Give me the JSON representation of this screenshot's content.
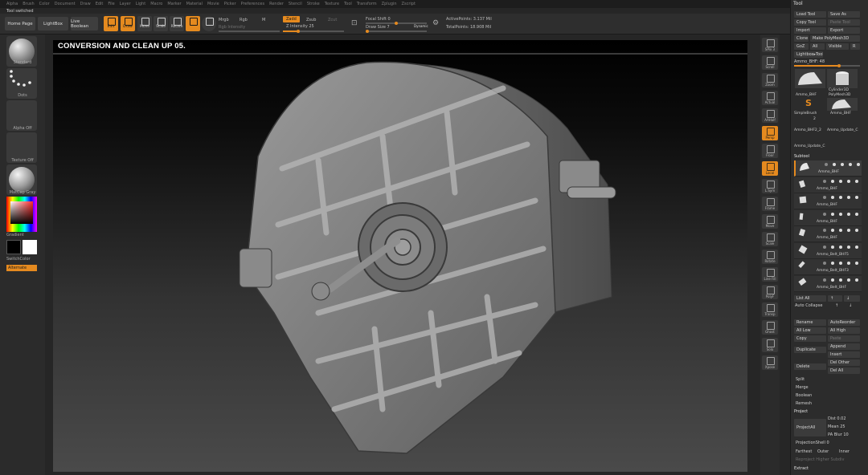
{
  "menu": [
    "Alpha",
    "Brush",
    "Color",
    "Document",
    "Draw",
    "Edit",
    "File",
    "Layer",
    "Light",
    "Macro",
    "Marker",
    "Material",
    "Movie",
    "Picker",
    "Preferences",
    "Render",
    "Stencil",
    "Stroke",
    "Texture",
    "Tool",
    "Transform",
    "Zplugin",
    "Zscript"
  ],
  "status": "Tool switched",
  "topbar": {
    "home": "Home Page",
    "lightbox": "LightBox",
    "live_boolean": "Live Boolean",
    "edit": "Edit",
    "draw": "Draw",
    "move": "Move",
    "scale": "Scale",
    "rotate": "Rotate",
    "mrgb": "Mrgb",
    "rgb": "Rgb",
    "m": "M",
    "rgb_intensity": "Rgb Intensity",
    "zadd": "Zadd",
    "zsub": "Zsub",
    "zcut": "Zcut",
    "z_intensity_label": "Z Intensity",
    "z_intensity": "25",
    "focal_label": "Focal Shift",
    "focal": "0",
    "draw_size_label": "Draw Size",
    "draw_size": "7",
    "dynamic": "Dynamic",
    "active_points": "ActivePoints: 3.137 Mil",
    "total_points": "TotalPoints: 18.908 Mil"
  },
  "left": {
    "brush": "Standard",
    "stroke": "Dots",
    "alpha": "Alpha Off",
    "texture": "Texture Off",
    "material": "MatCap Gray",
    "gradient": "Gradient",
    "switch_color": "SwitchColor",
    "alternate": "Alternate"
  },
  "canvas_title": "CONVERSION AND CLEAN UP 05.",
  "right_shelf": [
    "SPix 3",
    "Scroll",
    "Zoom",
    "Actual",
    "AAHalf",
    "Persp",
    "Floor",
    "Local",
    "L.Sym",
    "Frame",
    "Move",
    "Scale",
    "Rotate",
    "Line Fill",
    "PolyF",
    "Transp",
    "Ghost",
    "Solo",
    "Xpose"
  ],
  "tool": {
    "title": "Tool",
    "load": "Load Tool",
    "save": "Save As",
    "copy": "Copy Tool",
    "paste": "Paste Tool",
    "import": "Import",
    "export": "Export",
    "clone": "Clone",
    "make_polymesh": "Make PolyMesh3D",
    "goz": "GoZ",
    "all": "All",
    "visible": "Visible",
    "r": "R",
    "lightbox_tools": "Lightbox▸Tools",
    "current": "Ammo_BHF: 48",
    "thumbs": [
      "Ammo_BHF",
      "Cylinder3D",
      "PolyMesh3D",
      "SimpleBrush",
      "Ammo_BHF",
      "Ammo_BHF2_2",
      "Ammo_Update_C",
      "Ammo_Update_C"
    ],
    "thumb_num": "2",
    "subtool_title": "Subtool",
    "subtools": [
      "Ammo_BHF",
      "Ammo_BHF",
      "Ammo_BHF",
      "Ammo_BHF",
      "Ammo_BHF",
      "Ammo_Belt_BHF5",
      "Ammo_Belt_BHF3",
      "Ammo_Belt_BHF"
    ],
    "list_all": "List All",
    "auto_collapse": "Auto Collapse",
    "rename": "Rename",
    "autoreorder": "AutoReorder",
    "all_low": "All Low",
    "all_high": "All High",
    "copy2": "Copy",
    "paste2": "Paste",
    "duplicate": "Duplicate",
    "append": "Append",
    "insert": "Insert",
    "delete": "Delete",
    "del_other": "Del Other",
    "del_all": "Del All",
    "split": "Split",
    "merge": "Merge",
    "boolean": "Boolean",
    "remesh": "Remesh",
    "project": "Project",
    "project_all": "ProjectAll",
    "dist": "Dist 0.02",
    "mean": "Mean 25",
    "pa_blur": "PA Blur 10",
    "projection_shell": "ProjectionShell 0",
    "farthest": "Farthest",
    "outer": "Outer",
    "inner": "Inner",
    "reproject": "Reproject Higher Subdiv",
    "extract": "Extract"
  },
  "colors": {
    "accent": "#e58a1f",
    "panel": "#2c2c2c",
    "canvas_top": "#000000",
    "canvas_bottom": "#4a4a4a"
  }
}
